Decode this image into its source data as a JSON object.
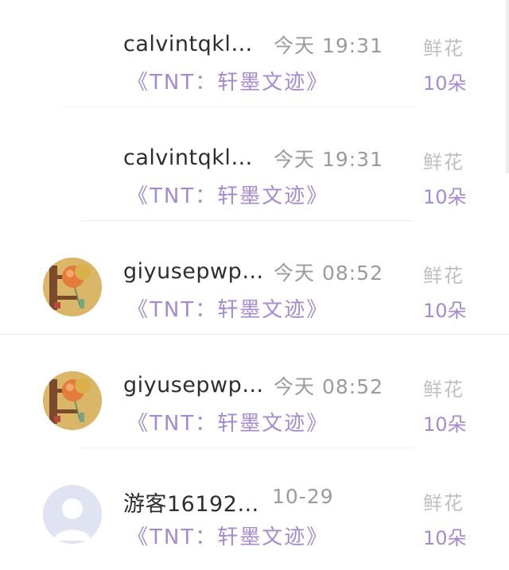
{
  "rows": [
    {
      "username": "calvintqkl…",
      "time": "今天 19:31",
      "work": "《TNT：轩墨文迹》",
      "gift_type": "鲜花",
      "gift_count": "10朵",
      "avatar": "none"
    },
    {
      "username": "calvintqkl…",
      "time": "今天 19:31",
      "work": "《TNT：轩墨文迹》",
      "gift_type": "鲜花",
      "gift_count": "10朵",
      "avatar": "none"
    },
    {
      "username": "giyusepwp…",
      "time": "今天 08:52",
      "work": "《TNT：轩墨文迹》",
      "gift_type": "鲜花",
      "gift_count": "10朵",
      "avatar": "balloon-avatar-icon"
    },
    {
      "username": "giyusepwp…",
      "time": "今天 08:52",
      "work": "《TNT：轩墨文迹》",
      "gift_type": "鲜花",
      "gift_count": "10朵",
      "avatar": "balloon-avatar-icon"
    },
    {
      "username": "游客16192…",
      "time": "10-29",
      "work": "《TNT：轩墨文迹》",
      "gift_type": "鲜花",
      "gift_count": "10朵",
      "avatar": "default-user-avatar-icon"
    }
  ],
  "colors": {
    "purple": "#a58ad2",
    "gray": "#9b9b9b",
    "light_gray": "#bfbfbf",
    "name": "#2e2e2e"
  }
}
